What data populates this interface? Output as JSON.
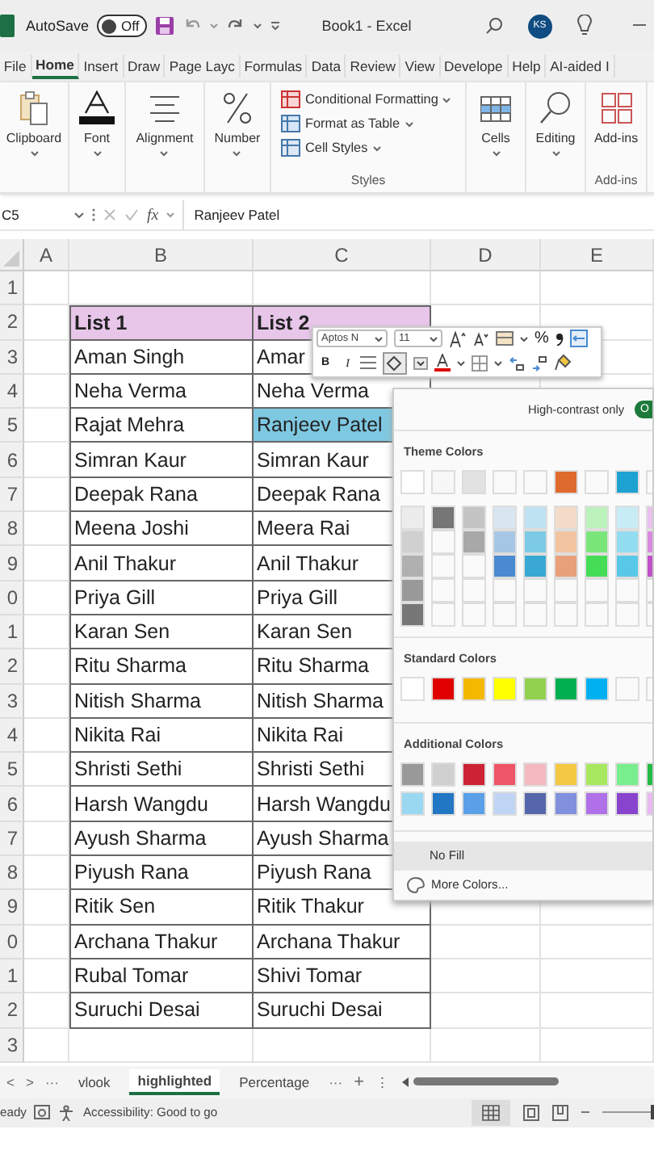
{
  "title_bar": {
    "autosave_label": "AutoSave",
    "autosave": {
      "label": "Off",
      "on": false
    },
    "title": "Book1  -  Excel",
    "avatar": "KS"
  },
  "ribbon_tabs": [
    {
      "label": "File",
      "selected": false
    },
    {
      "label": "Home",
      "selected": true
    },
    {
      "label": "Insert",
      "selected": false
    },
    {
      "label": "Draw",
      "selected": false
    },
    {
      "label": "Page Layc",
      "selected": false
    },
    {
      "label": "Formulas",
      "selected": false
    },
    {
      "label": "Data",
      "selected": false
    },
    {
      "label": "Review",
      "selected": false
    },
    {
      "label": "View",
      "selected": false
    },
    {
      "label": "Develope",
      "selected": false
    },
    {
      "label": "Help",
      "selected": false
    },
    {
      "label": "AI-aided I",
      "selected": false
    }
  ],
  "ribbon_groups": [
    {
      "kind": "button",
      "label": "Clipboard",
      "dropdown": true
    },
    {
      "kind": "button",
      "label": "Font",
      "dropdown": true
    },
    {
      "kind": "button",
      "label": "Alignment",
      "dropdown": true
    },
    {
      "kind": "button",
      "label": "Number",
      "dropdown": true
    },
    {
      "kind": "list",
      "label": "Styles",
      "items": [
        "Conditional Formatting",
        "Format as Table",
        "Cell Styles"
      ]
    },
    {
      "kind": "button",
      "label": "Cells",
      "dropdown": true
    },
    {
      "kind": "button",
      "label": "Editing",
      "dropdown": true
    },
    {
      "kind": "button",
      "label": "Add-ins",
      "dropdown": false,
      "group_label": "Add-ins"
    }
  ],
  "formula_bar": {
    "name_box": "C5",
    "fx": "fx",
    "formula": "Ranjeev Patel"
  },
  "columns": [
    "A",
    "B",
    "C",
    "D",
    "E"
  ],
  "rows": [
    {
      "number": "1",
      "kind": "blank"
    },
    {
      "number": "2",
      "kind": "header",
      "b": "List 1",
      "c": "List 2"
    },
    {
      "number": "3",
      "kind": "data",
      "b": "Aman Singh",
      "c": "Amar",
      "selected": false
    },
    {
      "number": "4",
      "kind": "data",
      "b": "Neha Verma",
      "c": "Neha Verma",
      "selected": false
    },
    {
      "number": "5",
      "kind": "data",
      "b": "Rajat Mehra",
      "c": "Ranjeev Patel",
      "selected": true
    },
    {
      "number": "6",
      "kind": "data",
      "b": "Simran Kaur",
      "c": "Simran Kaur",
      "selected": false
    },
    {
      "number": "7",
      "kind": "data",
      "b": "Deepak Rana",
      "c": "Deepak Rana",
      "selected": false
    },
    {
      "number": "8",
      "kind": "data",
      "b": "Meena Joshi",
      "c": "Meera Rai",
      "selected": false
    },
    {
      "number": "9",
      "kind": "data",
      "b": "Anil Thakur",
      "c": "Anil Thakur",
      "selected": false
    },
    {
      "number": "0",
      "kind": "data",
      "b": "Priya Gill",
      "c": "Priya Gill",
      "selected": false
    },
    {
      "number": "1",
      "kind": "data",
      "b": "Karan Sen",
      "c": "Karan Sen",
      "selected": false
    },
    {
      "number": "2",
      "kind": "data",
      "b": "Ritu Sharma",
      "c": "Ritu Sharma",
      "selected": false
    },
    {
      "number": "3",
      "kind": "data",
      "b": "Nitish Sharma",
      "c": "Nitish Sharma",
      "selected": false
    },
    {
      "number": "4",
      "kind": "data",
      "b": "Nikita Rai",
      "c": "Nikita Rai",
      "selected": false
    },
    {
      "number": "5",
      "kind": "data",
      "b": "Shristi Sethi",
      "c": "Shristi Sethi",
      "selected": false
    },
    {
      "number": "6",
      "kind": "data",
      "b": "Harsh Wangdu",
      "c": "Harsh Wangdu",
      "selected": false
    },
    {
      "number": "7",
      "kind": "data",
      "b": "Ayush Sharma",
      "c": "Ayush Sharma",
      "selected": false
    },
    {
      "number": "8",
      "kind": "data",
      "b": "Piyush Rana",
      "c": "Piyush Rana",
      "selected": false
    },
    {
      "number": "9",
      "kind": "data",
      "b": "Ritik Sen",
      "c": "Ritik Thakur",
      "selected": false
    },
    {
      "number": "0",
      "kind": "data",
      "b": "Archana Thakur",
      "c": "Archana Thakur",
      "selected": false
    },
    {
      "number": "1",
      "kind": "data",
      "b": "Rubal Tomar",
      "c": "Shivi Tomar",
      "selected": false
    },
    {
      "number": "2",
      "kind": "data",
      "b": "Suruchi Desai",
      "c": "Suruchi Desai",
      "selected": false
    },
    {
      "number": "3",
      "kind": "blank"
    }
  ],
  "mini_toolbar": {
    "font": "Aptos N",
    "size": "11",
    "percent": "%",
    "bold": "B",
    "italic": "I",
    "fill_pressed": true
  },
  "color_menu": {
    "high_contrast": {
      "label": "High-contrast only",
      "on": true,
      "text": "O"
    },
    "theme_title": "Theme Colors",
    "theme_colors": [
      {
        "color": "#ffffff"
      },
      {
        "color": "#f7f7f7"
      },
      {
        "color": "#e2e2e2"
      },
      {
        "color": "#fafafa"
      },
      {
        "color": "#fafafa"
      },
      {
        "color": "#de6a2e"
      },
      {
        "color": "#fafafa"
      },
      {
        "color": "#1ea2d2"
      },
      {
        "color": "#fafafa"
      }
    ],
    "theme_shades": [
      [
        {
          "color": "#ececec"
        },
        {
          "color": "#767676"
        },
        {
          "color": "#c4c4c4"
        },
        {
          "color": "#d8e6f2"
        },
        {
          "color": "#bfe2f2"
        },
        {
          "color": "#f4dcc8"
        },
        {
          "color": "#bcf2bc"
        },
        {
          "color": "#c8ecf6"
        },
        {
          "color": "#e8c2ec"
        }
      ],
      [
        {
          "color": "#d0d0d0"
        },
        {
          "color": "#fafafa"
        },
        {
          "color": "#a8a8a8"
        },
        {
          "color": "#a6c6e6"
        },
        {
          "color": "#7ccae6"
        },
        {
          "color": "#f2c4a0"
        },
        {
          "color": "#7ae67a"
        },
        {
          "color": "#92dcef"
        },
        {
          "color": "#d88ae0"
        }
      ],
      [
        {
          "color": "#b0b0b0"
        },
        {
          "color": "#fafafa"
        },
        {
          "color": "#fafafa"
        },
        {
          "color": "#4a8ad0"
        },
        {
          "color": "#39a8d2"
        },
        {
          "color": "#e8a07a"
        },
        {
          "color": "#44dd55"
        },
        {
          "color": "#58c8e8"
        },
        {
          "color": "#c050c8"
        }
      ],
      [
        {
          "color": "#999999"
        },
        {
          "color": "#fafafa"
        },
        {
          "color": "#fafafa"
        },
        {
          "color": "#fafafa"
        },
        {
          "color": "#fafafa"
        },
        {
          "color": "#fafafa"
        },
        {
          "color": "#fafafa"
        },
        {
          "color": "#fafafa"
        },
        {
          "color": "#fafafa"
        }
      ],
      [
        {
          "color": "#777777"
        },
        {
          "color": "#fafafa"
        },
        {
          "color": "#fafafa"
        },
        {
          "color": "#fafafa"
        },
        {
          "color": "#fafafa"
        },
        {
          "color": "#fafafa"
        },
        {
          "color": "#fafafa"
        },
        {
          "color": "#fafafa"
        },
        {
          "color": "#fafafa"
        }
      ]
    ],
    "standard_title": "Standard Colors",
    "standard_colors": [
      {
        "color": "#ffffff"
      },
      {
        "color": "#e00000"
      },
      {
        "color": "#f4b800"
      },
      {
        "color": "#ffff00"
      },
      {
        "color": "#92d050"
      },
      {
        "color": "#00b050"
      },
      {
        "color": "#00b0f0"
      },
      {
        "color": "#fafafa"
      },
      {
        "color": "#fafafa"
      }
    ],
    "additional_title": "Additional Colors",
    "additional_colors": [
      [
        {
          "color": "#999999"
        },
        {
          "color": "#d0d0d0"
        },
        {
          "color": "#cc2233"
        },
        {
          "color": "#ee5566"
        },
        {
          "color": "#f4b8c0"
        },
        {
          "color": "#f4c842"
        },
        {
          "color": "#a8e860"
        },
        {
          "color": "#78ee8c"
        },
        {
          "color": "#22bb44"
        }
      ],
      [
        {
          "color": "#99d8f0"
        },
        {
          "color": "#2277c4"
        },
        {
          "color": "#5aa0e8"
        },
        {
          "color": "#c0d4f4"
        },
        {
          "color": "#5566aa"
        },
        {
          "color": "#8090dd"
        },
        {
          "color": "#b070e8"
        },
        {
          "color": "#8844cc"
        },
        {
          "color": "#e8b8f0"
        }
      ]
    ],
    "no_fill": {
      "label": "No Fill",
      "highlighted": true
    },
    "more_colors": "More Colors..."
  },
  "sheet_tabs": {
    "prev": "<",
    "next": ">",
    "more": "···",
    "tabs": [
      {
        "label": "vlook",
        "selected": false
      },
      {
        "label": "highlighted",
        "selected": true
      },
      {
        "label": "Percentage",
        "selected": false
      }
    ],
    "more_after": "···",
    "add": "+",
    "menu": "⋮"
  },
  "status_bar": {
    "mode": "eady",
    "accessibility": "Accessibility: Good to go",
    "zoom": {
      "level": 0.5
    }
  }
}
